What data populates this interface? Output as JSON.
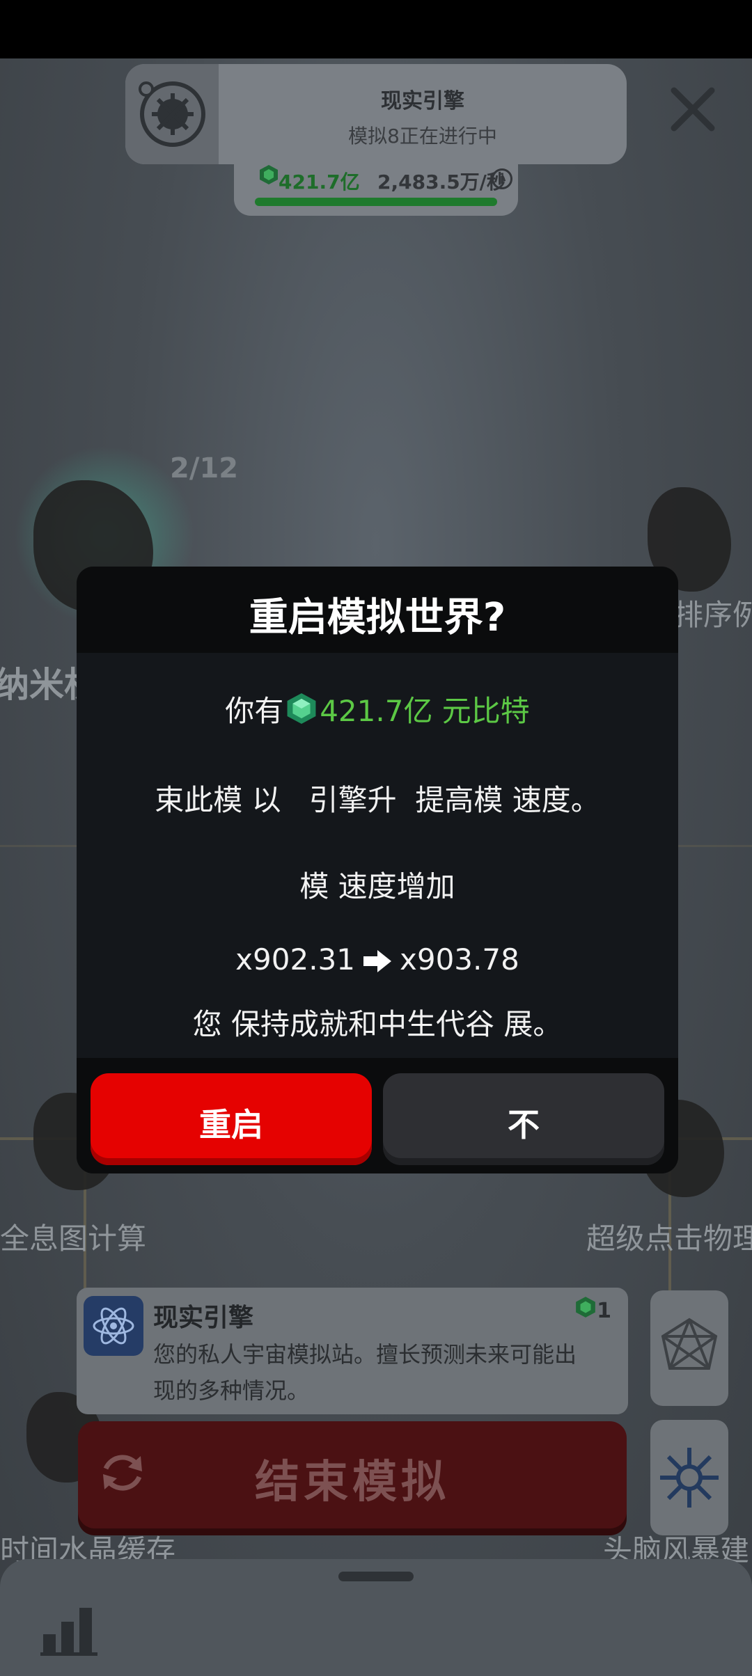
{
  "colors": {
    "accent_green": "#5cc845",
    "restart_red": "#e50201",
    "modal_bg": "#14171b",
    "dim_bg": "#474d53"
  },
  "header": {
    "engine_title": "现实引擎",
    "engine_status": "模拟8正在进行中",
    "resource_amount": "421.7亿",
    "resource_rate": "2,483.5万/秒",
    "info_icon": "info-icon",
    "close_icon": "close-icon"
  },
  "scene": {
    "page_count": "2/12",
    "labels": {
      "left_top": "纳米机",
      "right_top": "排序例",
      "left_mid": "全息图计算",
      "right_mid": "超级点击物理",
      "left_bottom": "时间水晶缓存",
      "right_bottom": "头脑风暴建"
    }
  },
  "modal": {
    "title": "重启模拟世界?",
    "you_have_label": "你有",
    "you_have_value": "421.7亿 元比特",
    "line1": "束此模 以   引擎升  提高模 速度。",
    "line2": "模 速度增加",
    "mult_from": "x902.31",
    "mult_to": "x903.78",
    "line3": "您 保持成就和中生代谷 展。",
    "restart_label": "重启",
    "no_label": "不"
  },
  "description_card": {
    "title": "现实引擎",
    "text": "您的私人宇宙模拟站。擅长预测未来可能出现的多种情况。",
    "count": "1"
  },
  "end_button": {
    "label": "结束模拟"
  }
}
